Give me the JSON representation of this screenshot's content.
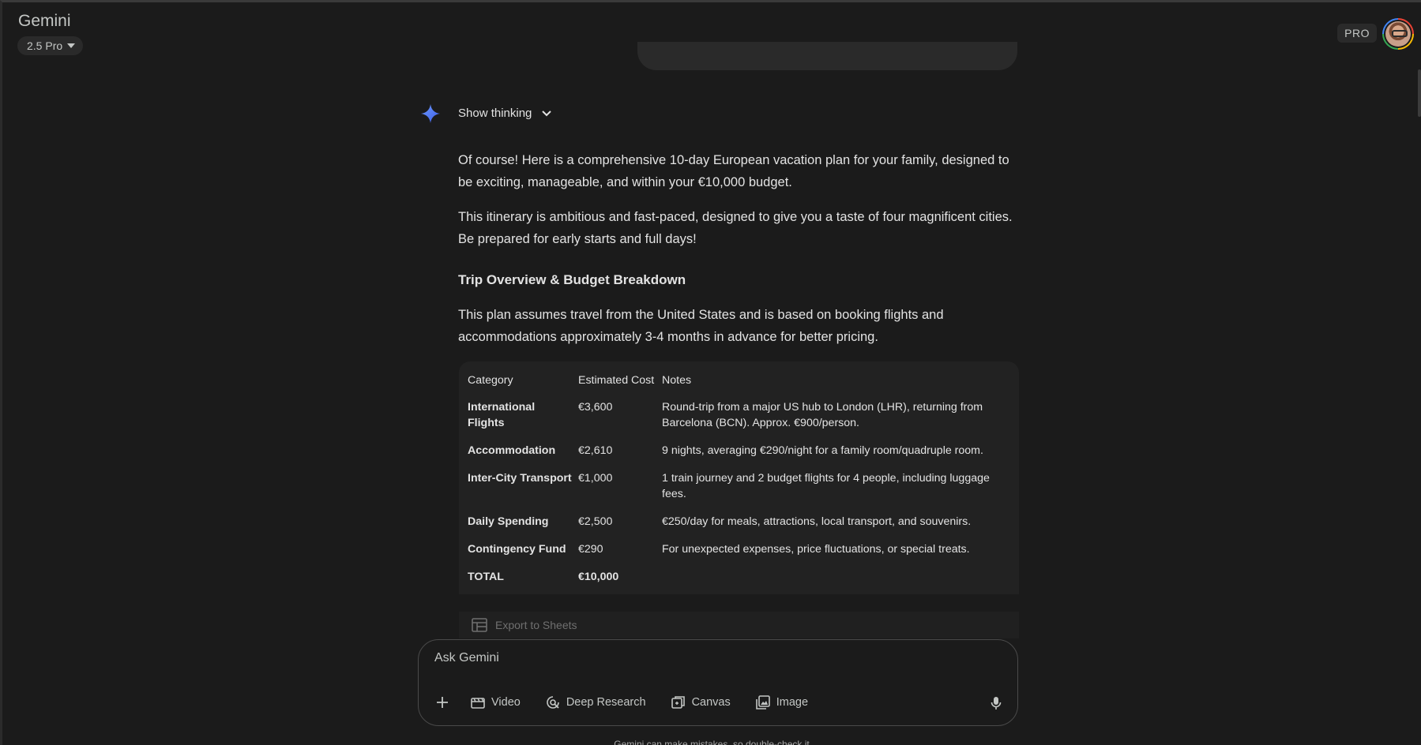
{
  "header": {
    "app_title": "Gemini",
    "model_label": "2.5 Pro",
    "pro_badge": "PRO"
  },
  "response": {
    "show_thinking_label": "Show thinking",
    "paragraphs": [
      "Of course! Here is a comprehensive 10-day European vacation plan for your family, designed to be exciting, manageable, and within your €10,000 budget.",
      "This itinerary is ambitious and fast-paced, designed to give you a taste of four magnificent cities. Be prepared for early starts and full days!"
    ],
    "section_heading": "Trip Overview & Budget Breakdown",
    "section_paragraph": "This plan assumes travel from the United States and is based on booking flights and accommodations approximately 3-4 months in advance for better pricing.",
    "table": {
      "headers": [
        "Category",
        "Estimated Cost",
        "Notes"
      ],
      "rows": [
        {
          "category": "International Flights",
          "cost": "€3,600",
          "notes": "Round-trip from a major US hub to London (LHR), returning from Barcelona (BCN). Approx. €900/person."
        },
        {
          "category": "Accommodation",
          "cost": "€2,610",
          "notes": "9 nights, averaging €290/night for a family room/quadruple room."
        },
        {
          "category": "Inter-City Transport",
          "cost": "€1,000",
          "notes": "1 train journey and 2 budget flights for 4 people, including luggage fees."
        },
        {
          "category": "Daily Spending",
          "cost": "€2,500",
          "notes": "€250/day for meals, attractions, local transport, and souvenirs."
        },
        {
          "category": "Contingency Fund",
          "cost": "€290",
          "notes": "For unexpected expenses, price fluctuations, or special treats."
        },
        {
          "category": "TOTAL",
          "cost": "€10,000",
          "notes": ""
        }
      ]
    },
    "export_label": "Export to Sheets"
  },
  "composer": {
    "placeholder": "Ask Gemini",
    "tools": [
      {
        "label": "Video",
        "icon": "video-icon"
      },
      {
        "label": "Deep Research",
        "icon": "deep-research-icon"
      },
      {
        "label": "Canvas",
        "icon": "canvas-icon"
      },
      {
        "label": "Image",
        "icon": "image-icon"
      }
    ]
  },
  "footer": {
    "disclaimer": "Gemini can make mistakes, so double-check it"
  },
  "colors": {
    "background": "#1b1b1b",
    "surface": "#222222",
    "text": "#e3e3e3",
    "accent_spark": "#4f7df5"
  }
}
